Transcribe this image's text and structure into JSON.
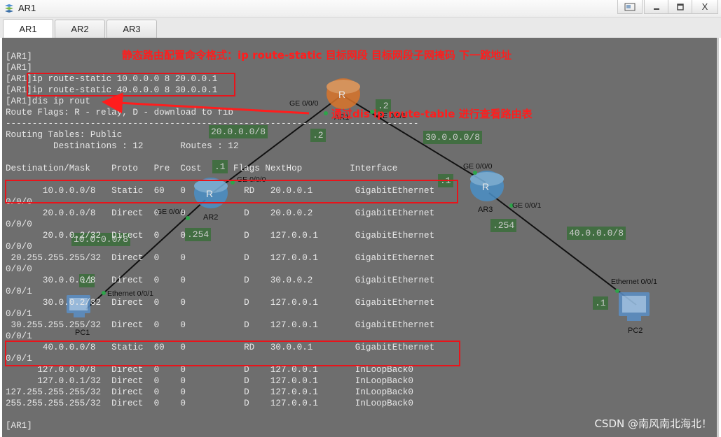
{
  "window": {
    "title": "AR1",
    "controls": [
      "restore-panel",
      "minimize",
      "maximize",
      "close"
    ],
    "close_label": "X"
  },
  "tabs": [
    {
      "label": "AR1",
      "active": true
    },
    {
      "label": "AR2",
      "active": false
    },
    {
      "label": "AR3",
      "active": false
    }
  ],
  "console": {
    "lines": [
      "[AR1]",
      "[AR1]",
      "[AR1]ip route-static 10.0.0.0 8 20.0.0.1",
      "[AR1]ip route-static 40.0.0.0 8 30.0.0.1",
      "[AR1]dis ip rout",
      "Route Flags: R - relay, D - download to fib",
      "------------------------------------------------------------------------------",
      "Routing Tables: Public",
      "         Destinations : 12       Routes : 12",
      "",
      "Destination/Mask    Proto   Pre  Cost      Flags NextHop         Interface",
      "",
      "       10.0.0.0/8   Static  60   0           RD   20.0.0.1        GigabitEthernet",
      "0/0/0",
      "       20.0.0.0/8   Direct  0    0           D    20.0.0.2        GigabitEthernet",
      "0/0/0",
      "       20.0.0.2/32  Direct  0    0           D    127.0.0.1       GigabitEthernet",
      "0/0/0",
      " 20.255.255.255/32  Direct  0    0           D    127.0.0.1       GigabitEthernet",
      "0/0/0",
      "       30.0.0.0/8   Direct  0    0           D    30.0.0.2        GigabitEthernet",
      "0/0/1",
      "       30.0.0.2/32  Direct  0    0           D    127.0.0.1       GigabitEthernet",
      "0/0/1",
      " 30.255.255.255/32  Direct  0    0           D    127.0.0.1       GigabitEthernet",
      "0/0/1",
      "       40.0.0.0/8   Static  60   0           RD   30.0.0.1        GigabitEthernet",
      "0/0/1",
      "      127.0.0.0/8   Direct  0    0           D    127.0.0.1       InLoopBack0",
      "      127.0.0.1/32  Direct  0    0           D    127.0.0.1       InLoopBack0",
      "127.255.255.255/32  Direct  0    0           D    127.0.0.1       InLoopBack0",
      "255.255.255.255/32  Direct  0    0           D    127.0.0.1       InLoopBack0",
      "",
      "[AR1]"
    ]
  },
  "annotations": {
    "static_route_format": "静态路由配置命令格式：ip route-static 目标网段  目标网段子网掩码  下一跳地址",
    "view_table_hint": "通过dis ip route-table 进行查看路由表"
  },
  "topology": {
    "devices": [
      {
        "name": "AR1"
      },
      {
        "name": "AR2"
      },
      {
        "name": "AR3"
      },
      {
        "name": "PC1"
      },
      {
        "name": "PC2"
      }
    ],
    "networks": [
      "20.0.0.0/8",
      "30.0.0.0/8",
      "10.0.0.0/8",
      "40.0.0.0/8"
    ],
    "address_labels": [
      ".2",
      ".2",
      ".1",
      ".1",
      ".254",
      ".254",
      ".1",
      ".1"
    ],
    "ports": [
      "GE 0/0/0",
      "GE 0/0/1",
      "GE 0/0/0",
      "GE 0/0/1",
      "GE 0/0/0",
      "GE 0/0/1",
      "Ethernet 0/0/1",
      "Ethernet 0/0/1"
    ],
    "colors": {
      "router": "#4a8fc7",
      "router_ar1": "#d9742b",
      "link": "#111111",
      "net_label_bg": "#3e6e3e",
      "annotation": "#ff1d1d"
    }
  },
  "watermark": "CSDN @南风南北海北！"
}
